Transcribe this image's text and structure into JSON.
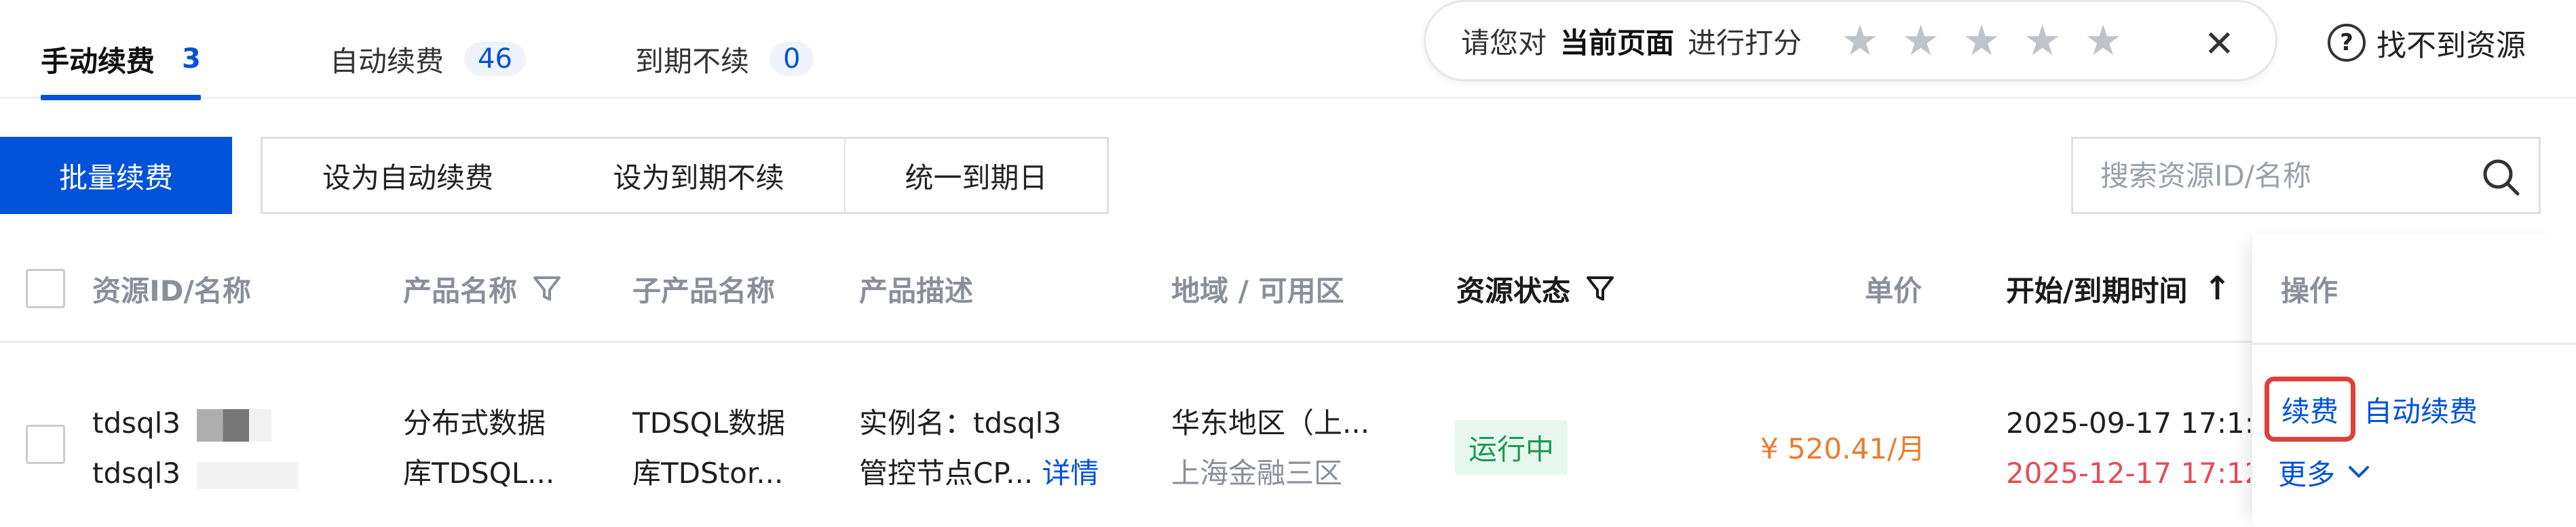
{
  "tabs": [
    {
      "label": "手动续费",
      "count": "3"
    },
    {
      "label": "自动续费",
      "count": "46"
    },
    {
      "label": "到期不续",
      "count": "0"
    }
  ],
  "rating": {
    "prefix": "请您对",
    "bold": "当前页面",
    "suffix": "进行打分",
    "stars": [
      "★",
      "★",
      "★",
      "★",
      "★"
    ],
    "close": "✕"
  },
  "help": {
    "label": "找不到资源",
    "icon": "?"
  },
  "toolbar": {
    "batch_renew": "批量续费",
    "set_auto": "设为自动续费",
    "set_expire": "设为到期不续",
    "unify_date": "统一到期日"
  },
  "search": {
    "placeholder": "搜索资源ID/名称"
  },
  "columns": {
    "resource": "资源ID/名称",
    "product": "产品名称",
    "subproduct": "子产品名称",
    "desc": "产品描述",
    "region": "地域 / 可用区",
    "status": "资源状态",
    "price": "单价",
    "time": "开始/到期时间",
    "sort_arrow": "↑",
    "ops": "操作"
  },
  "rows": [
    {
      "id": "tdsql3",
      "name": "tdsql3",
      "product_line1": "分布式数据",
      "product_line2": "库TDSQL...",
      "sub_line1": "TDSQL数据",
      "sub_line2": "库TDStor...",
      "desc_line1": "实例名：tdsql3",
      "desc_line2": "管控节点CP...",
      "desc_link": "详情",
      "region": "华东地区（上...",
      "zone": "上海金融三区",
      "status": "运行中",
      "price": "¥ 520.41/月",
      "start": "2025-09-17 17:1:",
      "end": "2025-12-17 17:12",
      "ops": {
        "renew": "续费",
        "auto": "自动续费",
        "more": "更多"
      }
    }
  ],
  "colors": {
    "primary": "#0052d9",
    "danger": "#e34d59",
    "price": "#ed7b2f",
    "success": "#1a9b53"
  }
}
